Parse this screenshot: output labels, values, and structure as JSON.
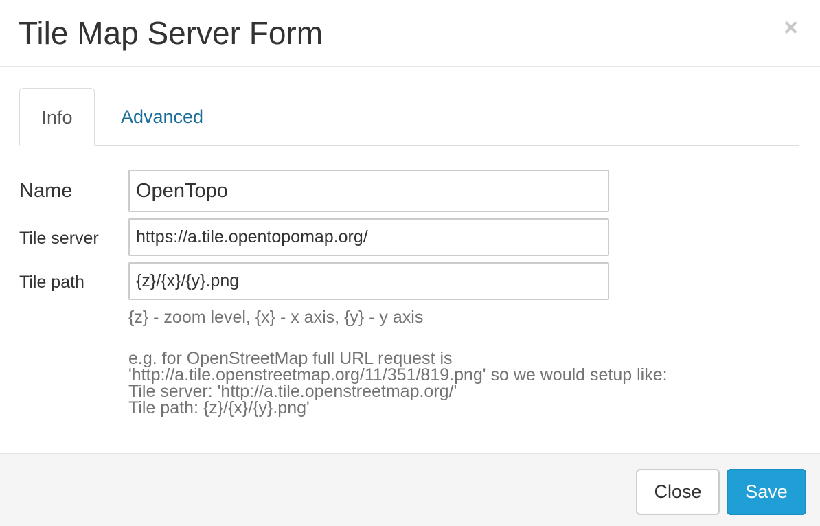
{
  "modal": {
    "title": "Tile Map Server Form",
    "close_glyph": "×"
  },
  "tabs": [
    {
      "label": "Info",
      "active": true
    },
    {
      "label": "Advanced",
      "active": false
    }
  ],
  "form": {
    "name": {
      "label": "Name",
      "value": "OpenTopo"
    },
    "tile_server": {
      "label": "Tile server",
      "value": "https://a.tile.opentopomap.org/"
    },
    "tile_path": {
      "label": "Tile path",
      "value": "{z}/{x}/{y}.png"
    }
  },
  "help": {
    "legend": "{z} - zoom level, {x} - x axis, {y} - y axis",
    "example_lines": [
      "e.g. for OpenStreetMap full URL request is",
      "'http://a.tile.openstreetmap.org/11/351/819.png' so we would setup like:",
      "Tile server: 'http://a.tile.openstreetmap.org/'",
      "Tile path: {z}/{x}/{y}.png'"
    ]
  },
  "footer": {
    "close_label": "Close",
    "save_label": "Save"
  },
  "colors": {
    "link": "#1a6e99",
    "primary": "#1f9fd6",
    "help_text": "#737373"
  }
}
